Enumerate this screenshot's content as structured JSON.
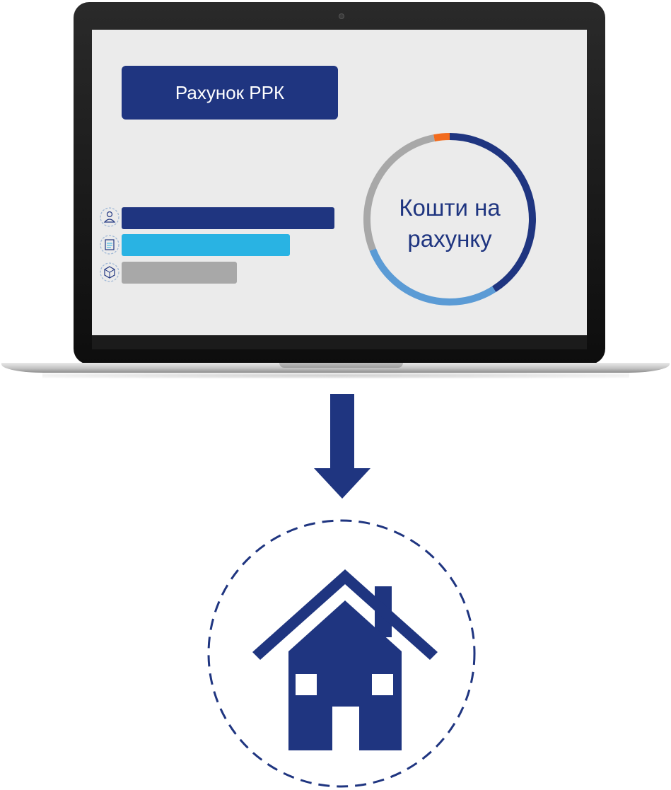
{
  "screen": {
    "title": "Рахунок РРК",
    "donut_label_line1": "Кошти на",
    "donut_label_line2": "рахунку"
  },
  "colors": {
    "navy": "#1f3580",
    "cyan": "#29b3e3",
    "gray": "#a8a8a8",
    "light_blue": "#5b9bd5",
    "orange": "#f26b1d"
  },
  "bars": [
    {
      "icon": "person-icon",
      "level": 1.0
    },
    {
      "icon": "document-icon",
      "level": 0.79
    },
    {
      "icon": "box-icon",
      "level": 0.54
    }
  ],
  "donut_segments": [
    {
      "color": "navy",
      "share": 0.41
    },
    {
      "color": "light_blue",
      "share": 0.28
    },
    {
      "color": "gray",
      "share": 0.28
    },
    {
      "color": "orange",
      "share": 0.03
    }
  ]
}
